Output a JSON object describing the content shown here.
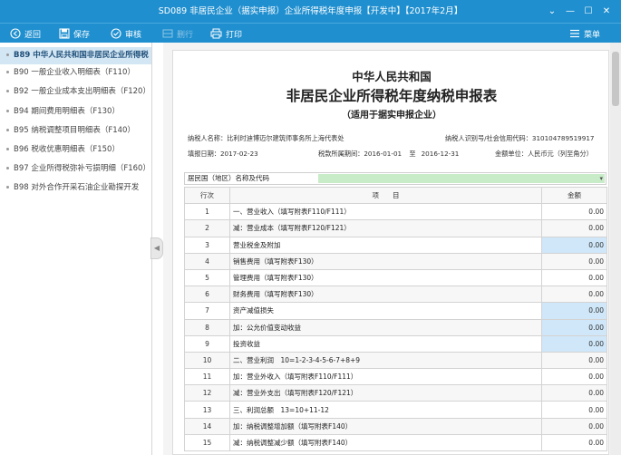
{
  "window": {
    "title": "SD089 非居民企业（据实申报）企业所得税年度申报【开发中】【2017年2月】",
    "controls": [
      "⌄",
      "—",
      "☐",
      "✕"
    ]
  },
  "toolbar": {
    "back": "返回",
    "save": "保存",
    "review": "审核",
    "delete": "删行",
    "print": "打印",
    "menu": "菜单"
  },
  "sidebar": {
    "items": [
      {
        "label": "B89 中华人民共和国非居民企业所得税",
        "active": true
      },
      {
        "label": "B90 一般企业收入明细表（F110）",
        "active": false
      },
      {
        "label": "B92 一般企业成本支出明细表（F120）",
        "active": false
      },
      {
        "label": "B94 期间费用明细表（F130）",
        "active": false
      },
      {
        "label": "B95 纳税调整项目明细表（F140）",
        "active": false
      },
      {
        "label": "B96 税收优惠明细表（F150）",
        "active": false
      },
      {
        "label": "B97 企业所得税弥补亏损明细（F160）",
        "active": false
      },
      {
        "label": "B98 对外合作开采石油企业勘探开发",
        "active": false
      }
    ]
  },
  "form": {
    "title_line1": "中华人民共和国",
    "title_line2": "非居民企业所得税年度纳税申报表",
    "title_line3": "（适用于据实申报企业）",
    "taxpayer_label": "纳税人名称：",
    "taxpayer_name": "比利时迪博迈尔建筑师事务所上海代表处",
    "taxid_label": "纳税人识别号/社会信用代码：",
    "taxid_value": "310104789519917",
    "filldate_label": "填报日期：",
    "filldate_value": "2017-02-23",
    "period_label": "税款所属期间：",
    "period_start": "2016-01-01",
    "period_to": "至",
    "period_end": "2016-12-31",
    "unit_label": "金额单位：",
    "unit_value": "人民币元（列至角分）",
    "country_label": "居民国（地区）名称及代码",
    "col_line": "行次",
    "col_item": "项　　目",
    "col_amount": "金额",
    "rows": [
      {
        "line": "1",
        "item": "一、营业收入（填写附表F110/F111）",
        "amount": "0.00",
        "hl": false
      },
      {
        "line": "2",
        "item": "减：营业成本（填写附表F120/F121）",
        "amount": "0.00",
        "hl": false
      },
      {
        "line": "3",
        "item": "营业税金及附加",
        "amount": "0.00",
        "hl": true
      },
      {
        "line": "4",
        "item": "销售费用（填写附表F130）",
        "amount": "0.00",
        "hl": false
      },
      {
        "line": "5",
        "item": "管理费用（填写附表F130）",
        "amount": "0.00",
        "hl": false
      },
      {
        "line": "6",
        "item": "财务费用（填写附表F130）",
        "amount": "0.00",
        "hl": false
      },
      {
        "line": "7",
        "item": "资产减值损失",
        "amount": "0.00",
        "hl": true
      },
      {
        "line": "8",
        "item": "加：公允价值变动收益",
        "amount": "0.00",
        "hl": true
      },
      {
        "line": "9",
        "item": "投资收益",
        "amount": "0.00",
        "hl": true
      },
      {
        "line": "10",
        "item": "二、营业利润　10=1-2-3-4-5-6-7+8+9",
        "amount": "0.00",
        "hl": false
      },
      {
        "line": "11",
        "item": "加：营业外收入（填写附表F110/F111）",
        "amount": "0.00",
        "hl": false
      },
      {
        "line": "12",
        "item": "减：营业外支出（填写附表F120/F121）",
        "amount": "0.00",
        "hl": false
      },
      {
        "line": "13",
        "item": "三、利润总额　13=10+11-12",
        "amount": "0.00",
        "hl": false
      },
      {
        "line": "14",
        "item": "加：纳税调整增加额（填写附表F140）",
        "amount": "0.00",
        "hl": false
      },
      {
        "line": "15",
        "item": "减：纳税调整减少额（填写附表F140）",
        "amount": "0.00",
        "hl": false
      }
    ]
  },
  "colors": {
    "titlebar": "#1f8fcf",
    "active_item": "#d3e6f4",
    "input_highlight": "#cfe7f8",
    "country_field": "#c8ecc8"
  }
}
